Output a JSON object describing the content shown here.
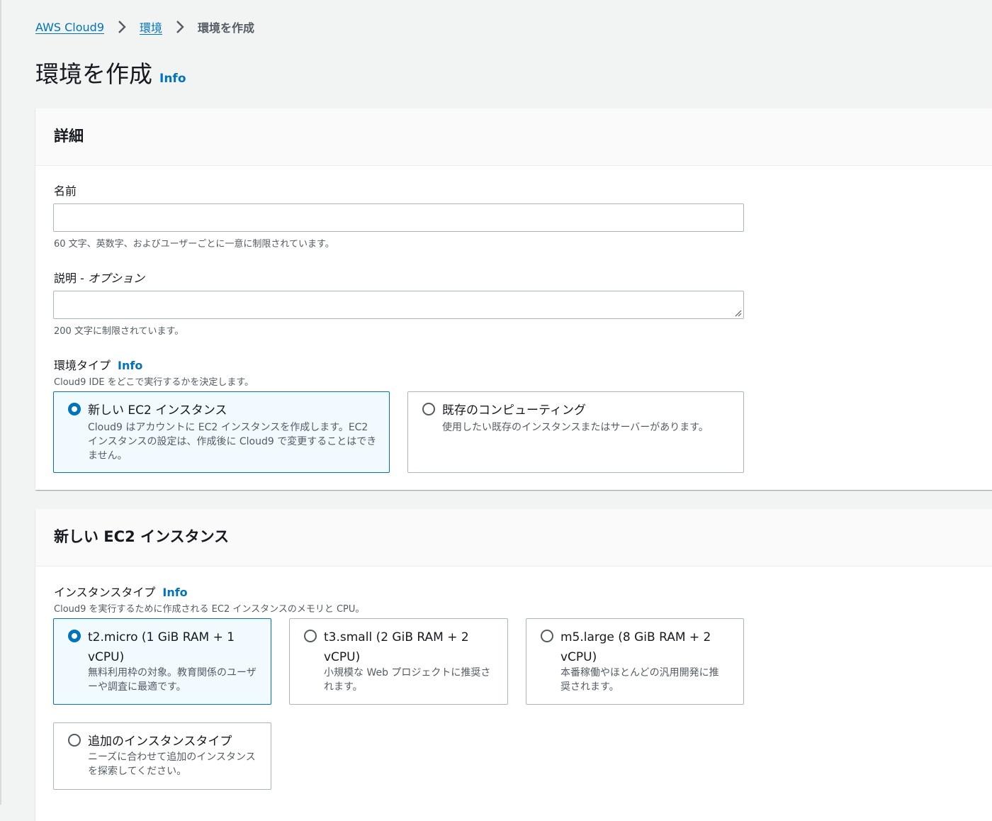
{
  "breadcrumb": {
    "items": [
      "AWS Cloud9",
      "環境"
    ],
    "current": "環境を作成"
  },
  "page": {
    "title": "環境を作成",
    "info": "Info"
  },
  "details": {
    "title": "詳細",
    "name": {
      "label": "名前",
      "value": "",
      "placeholder": "",
      "hint": "60 文字、英数字、およびユーザーごとに一意に制限されています。"
    },
    "description": {
      "label": "説明",
      "optional_sep": " - ",
      "optional": "オプション",
      "value": "",
      "hint": "200 文字に制限されています。"
    },
    "env_type": {
      "label": "環境タイプ",
      "info": "Info",
      "hint": "Cloud9 IDE をどこで実行するかを決定します。",
      "options": [
        {
          "title": "新しい EC2 インスタンス",
          "desc": "Cloud9 はアカウントに EC2 インスタンスを作成します。EC2 インスタンスの設定は、作成後に Cloud9 で変更することはできません。",
          "selected": true
        },
        {
          "title": "既存のコンピューティング",
          "desc": "使用したい既存のインスタンスまたはサーバーがあります。",
          "selected": false
        }
      ]
    }
  },
  "ec2": {
    "title": "新しい EC2 インスタンス",
    "instance_type": {
      "label": "インスタンスタイプ",
      "info": "Info",
      "hint": "Cloud9 を実行するために作成される EC2 インスタンスのメモリと CPU。",
      "options": [
        {
          "title": "t2.micro (1 GiB RAM + 1 vCPU)",
          "desc": "無料利用枠の対象。教育関係のユーザーや調査に最適です。",
          "selected": true
        },
        {
          "title": "t3.small (2 GiB RAM + 2 vCPU)",
          "desc": "小規模な Web プロジェクトに推奨されます。",
          "selected": false
        },
        {
          "title": "m5.large (8 GiB RAM + 2 vCPU)",
          "desc": "本番稼働やほとんどの汎用開発に推奨されます。",
          "selected": false
        },
        {
          "title": "追加のインスタンスタイプ",
          "desc": "ニーズに合わせて追加のインスタンスを探索してください。",
          "selected": false
        }
      ]
    }
  },
  "colors": {
    "accent": "#0073bb",
    "selected_bg": "#f1faff",
    "border": "#aab7b8"
  }
}
